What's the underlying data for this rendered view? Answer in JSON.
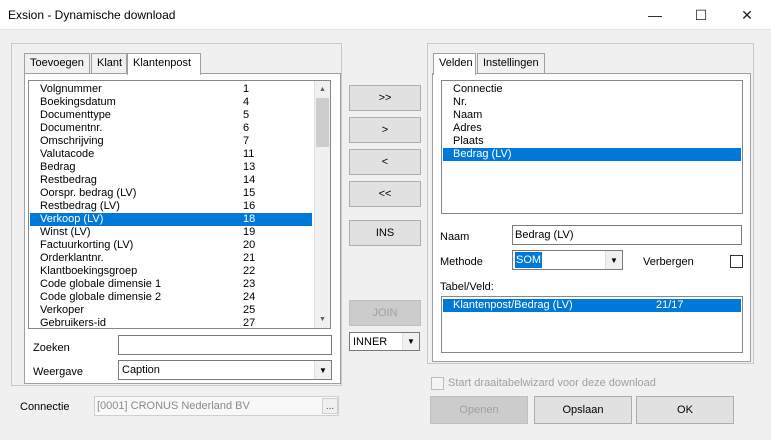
{
  "window": {
    "title": "Exsion - Dynamische download",
    "min_glyph": "—",
    "max_glyph": "☐",
    "close_glyph": "✕"
  },
  "left_tabs": [
    {
      "label": "Toevoegen"
    },
    {
      "label": "Klant"
    },
    {
      "label": "Klantenpost"
    }
  ],
  "fields_list": [
    {
      "label": "Volgnummer",
      "num": "1"
    },
    {
      "label": "Boekingsdatum",
      "num": "4"
    },
    {
      "label": "Documenttype",
      "num": "5"
    },
    {
      "label": "Documentnr.",
      "num": "6"
    },
    {
      "label": "Omschrijving",
      "num": "7"
    },
    {
      "label": "Valutacode",
      "num": "11"
    },
    {
      "label": "Bedrag",
      "num": "13"
    },
    {
      "label": "Restbedrag",
      "num": "14"
    },
    {
      "label": "Oorspr. bedrag (LV)",
      "num": "15"
    },
    {
      "label": "Restbedrag (LV)",
      "num": "16"
    },
    {
      "label": "Verkoop (LV)",
      "num": "18"
    },
    {
      "label": "Winst (LV)",
      "num": "19"
    },
    {
      "label": "Factuurkorting (LV)",
      "num": "20"
    },
    {
      "label": "Orderklantnr.",
      "num": "21"
    },
    {
      "label": "Klantboekingsgroep",
      "num": "22"
    },
    {
      "label": "Code globale dimensie 1",
      "num": "23"
    },
    {
      "label": "Code globale dimensie 2",
      "num": "24"
    },
    {
      "label": "Verkoper",
      "num": "25"
    },
    {
      "label": "Gebruikers-id",
      "num": "27"
    }
  ],
  "fields_list_selected_index": 10,
  "search": {
    "label": "Zoeken",
    "value": ""
  },
  "display": {
    "label": "Weergave",
    "value": "Caption"
  },
  "connection": {
    "label": "Connectie",
    "value": "[0001] CRONUS Nederland BV",
    "browse_label": "..."
  },
  "transfer_buttons": {
    "add_all": ">>",
    "add": ">",
    "remove": "<",
    "remove_all": "<<",
    "ins": "INS",
    "join": "JOIN"
  },
  "join_type": {
    "value": "INNER"
  },
  "right_tabs": [
    {
      "label": "Velden"
    },
    {
      "label": "Instellingen"
    }
  ],
  "selected_fields": [
    "Connectie",
    "Nr.",
    "Naam",
    "Adres",
    "Plaats",
    "Bedrag (LV)"
  ],
  "selected_fields_selected_index": 5,
  "field_props": {
    "name_label": "Naam",
    "name_value": "Bedrag (LV)",
    "method_label": "Methode",
    "method_value": "SOM",
    "hide_label": "Verbergen",
    "table_field_label": "Tabel/Veld:",
    "table_field_row": {
      "path": "Klantenpost/Bedrag (LV)",
      "ids": "21/17"
    }
  },
  "pivot_wizard": {
    "label": "Start draaitabelwizard voor deze download"
  },
  "footer_buttons": {
    "open": "Openen",
    "save": "Opslaan",
    "ok": "OK"
  }
}
